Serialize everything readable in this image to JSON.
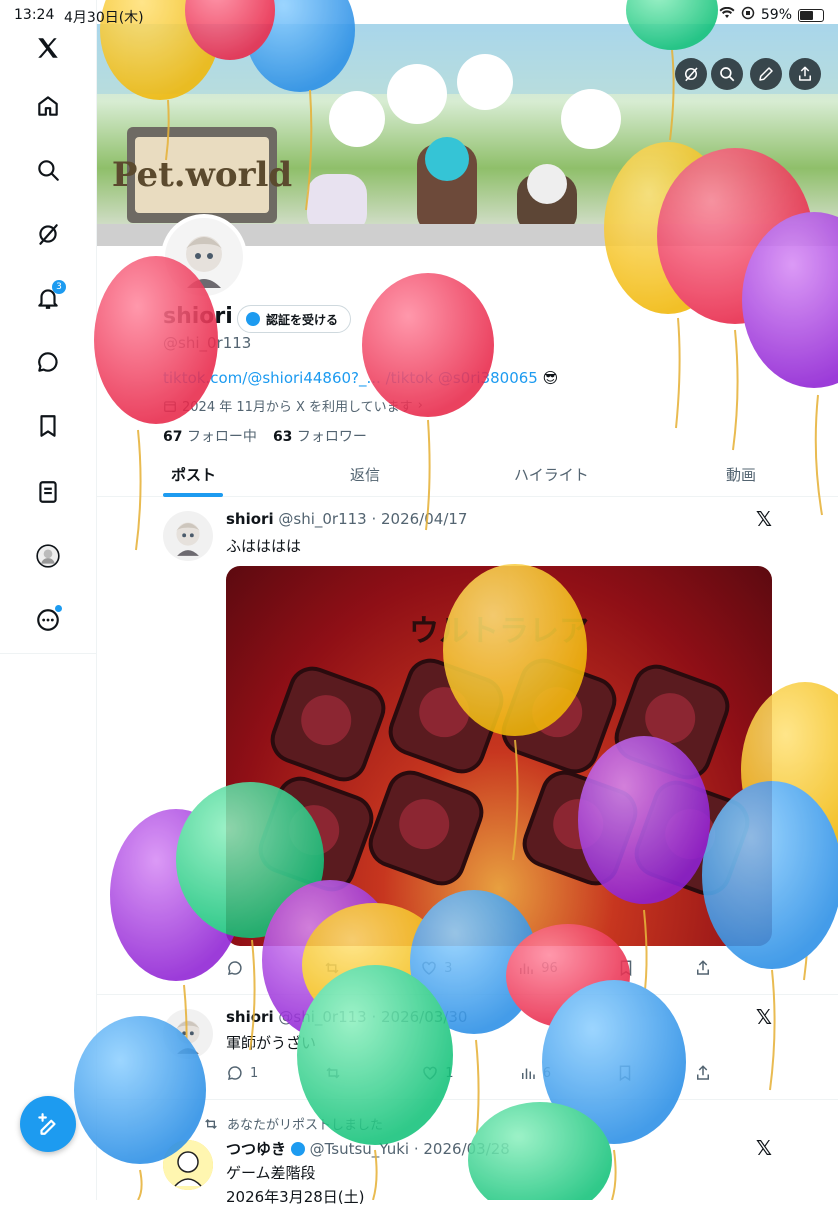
{
  "status_bar": {
    "time": "13:24",
    "date": "4月30日(木)",
    "battery": "59%"
  },
  "sidebar": {
    "items": [
      {
        "name": "x-logo",
        "icon": "x-logo-icon"
      },
      {
        "name": "home",
        "icon": "home-icon"
      },
      {
        "name": "search",
        "icon": "search-icon"
      },
      {
        "name": "grok",
        "icon": "grok-icon"
      },
      {
        "name": "notifications",
        "icon": "bell-icon",
        "badge": "3"
      },
      {
        "name": "messages",
        "icon": "chat-icon"
      },
      {
        "name": "bookmarks",
        "icon": "bookmark-icon"
      },
      {
        "name": "lists",
        "icon": "list-icon"
      },
      {
        "name": "profile",
        "icon": "avatar-icon"
      },
      {
        "name": "more",
        "icon": "more-icon"
      }
    ]
  },
  "profile": {
    "name": "shiori",
    "verify_label": "認証を受ける",
    "handle": "@shi_0r113",
    "bio_link": "tiktok.com/@shiori44860?_... /tiktok @s0ri380065",
    "bio_emoji": "😎",
    "joined": "2024 年 11月から X を利用しています",
    "following_count": "67",
    "following_label": "フォロー中",
    "followers_count": "63",
    "followers_label": "フォロワー",
    "banner_sign": "Pet.world"
  },
  "tabs": [
    "ポスト",
    "返信",
    "ハイライト",
    "動画"
  ],
  "posts": [
    {
      "name": "shiori",
      "handle_date": "@shi_0r113 · 2026/04/17",
      "text": "ふはははは",
      "media_title": "ウルトラレア",
      "actions": {
        "reply": "",
        "repost": "",
        "like": "3",
        "views": "96"
      }
    },
    {
      "name": "shiori",
      "handle_date": "@shi_0r113 · 2026/03/30",
      "text": "軍師がうざい",
      "actions": {
        "reply": "1",
        "repost": "",
        "like": "1",
        "views": "6"
      }
    },
    {
      "repost_note": "あなたがリポストしました",
      "name": "つつゆき",
      "handle_date": "@Tsutsu_Yuki · 2026/03/28",
      "text": "ゲーム差階段",
      "text2": "2026年3月28日(土)"
    }
  ],
  "colors": {
    "accent": "#1d9bf0",
    "text": "#0f1419",
    "muted": "#536471"
  }
}
